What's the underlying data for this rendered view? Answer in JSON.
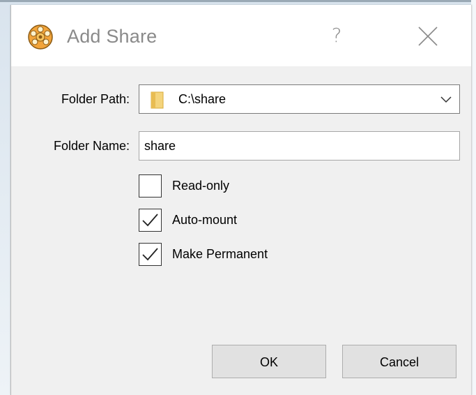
{
  "dialog": {
    "title": "Add Share",
    "help_label": "?",
    "icon": "virtualbox-gear-icon"
  },
  "form": {
    "folder_path_label": "Folder Path:",
    "folder_path_value": "C:\\share",
    "folder_name_label": "Folder Name:",
    "folder_name_value": "share"
  },
  "options": [
    {
      "label": "Read-only",
      "checked": false
    },
    {
      "label": "Auto-mount",
      "checked": true
    },
    {
      "label": "Make Permanent",
      "checked": true
    }
  ],
  "buttons": {
    "ok": "OK",
    "cancel": "Cancel"
  },
  "colors": {
    "dialog_bg": "#f0f0f0",
    "titlebar_bg": "#ffffff",
    "button_bg": "#e1e1e1"
  }
}
